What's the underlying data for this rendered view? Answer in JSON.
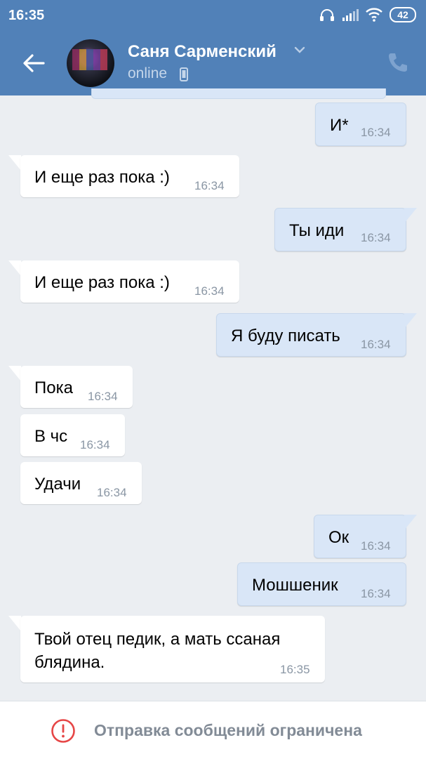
{
  "status_bar": {
    "time": "16:35",
    "battery": "42"
  },
  "header": {
    "contact_name": "Саня Сарменский",
    "presence": "online"
  },
  "messages": [
    {
      "dir": "out",
      "text": "И*",
      "time": "16:34"
    },
    {
      "dir": "in",
      "text": "И еще раз пока :)",
      "time": "16:34"
    },
    {
      "dir": "out",
      "text": "Ты иди",
      "time": "16:34"
    },
    {
      "dir": "in",
      "text": "И еще раз пока :)",
      "time": "16:34"
    },
    {
      "dir": "out",
      "text": "Я буду писать",
      "time": "16:34"
    },
    {
      "dir": "in",
      "text": "Пока",
      "time": "16:34"
    },
    {
      "dir": "in",
      "text": "В чс",
      "time": "16:34"
    },
    {
      "dir": "in",
      "text": "Удачи",
      "time": "16:34"
    },
    {
      "dir": "out",
      "text": "Ок",
      "time": "16:34"
    },
    {
      "dir": "out",
      "text": "Мошшеник",
      "time": "16:34"
    },
    {
      "dir": "in",
      "text_line1": "Твой отец педик, а мать ссаная",
      "text_line2": "блядина.",
      "time": "16:35"
    }
  ],
  "footer": {
    "restriction_text": "Отправка сообщений ограничена"
  },
  "colors": {
    "header": "#5181b8",
    "background": "#ebeef2",
    "outgoing": "#d9e6f7",
    "incoming": "#ffffff",
    "warning": "#e64646"
  },
  "icons": [
    "back-arrow-icon",
    "chevron-down-icon",
    "mobile-icon",
    "phone-icon",
    "headphones-icon",
    "signal-icon",
    "wifi-icon",
    "battery-icon",
    "warning-circle-icon"
  ]
}
